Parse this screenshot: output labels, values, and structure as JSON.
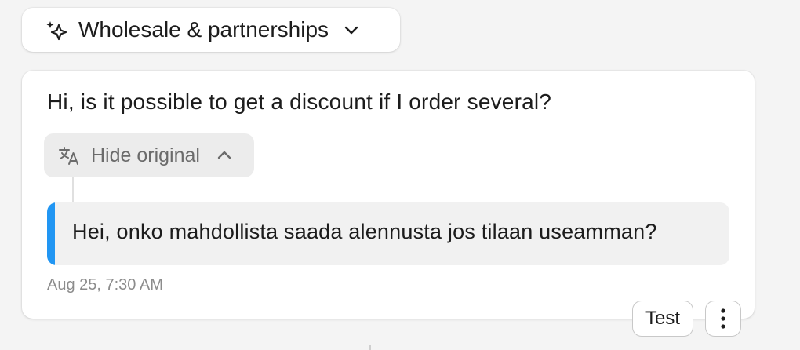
{
  "topic": {
    "label": "Wholesale & partnerships",
    "icon": "sparkle-icon",
    "dropdown_icon": "chevron-down-icon"
  },
  "message": {
    "text": "Hi, is it possible to get a discount if I order several?",
    "toggle": {
      "label": "Hide original",
      "icon": "translate-icon",
      "chevron": "chevron-up-icon"
    },
    "original_text": "Hei, onko mahdollista saada alennusta jos tilaan useamman?",
    "timestamp": "Aug 25, 7:30 AM"
  },
  "actions": {
    "test_label": "Test",
    "more_icon": "more-vertical-icon"
  },
  "colors": {
    "accent": "#2196f3",
    "background": "#f4f4f4",
    "card": "#ffffff",
    "chip": "#ececec"
  }
}
